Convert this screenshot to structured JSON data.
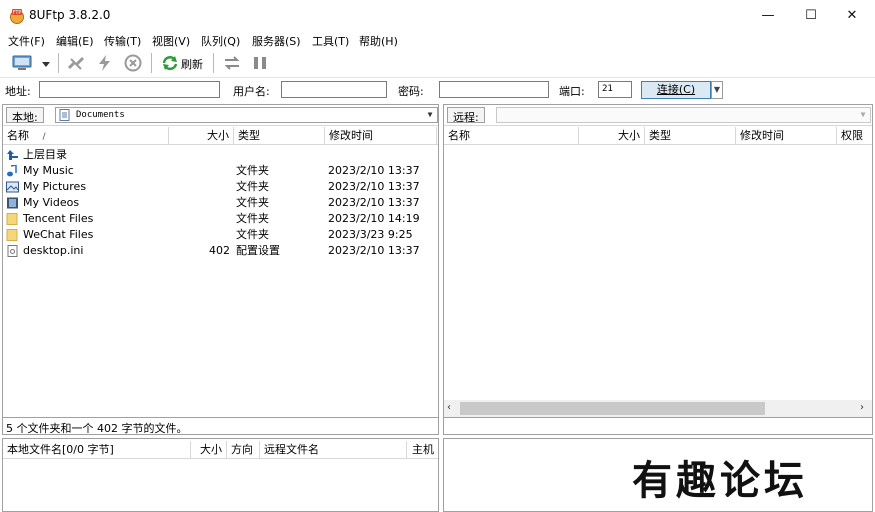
{
  "window": {
    "title": "8UFtp 3.8.2.0",
    "minimize": "—",
    "maximize": "☐",
    "close": "✕"
  },
  "menu": [
    "文件(F)",
    "编辑(E)",
    "传输(T)",
    "视图(V)",
    "队列(Q)",
    "服务器(S)",
    "工具(T)",
    "帮助(H)"
  ],
  "toolbar": {
    "refresh_label": "刷新",
    "icons": [
      "site-manager-icon",
      "dropdown-arrow-icon",
      "disconnect-icon",
      "quick-connect-icon",
      "cancel-icon",
      "refresh-icon",
      "sync-icon",
      "pause-icon"
    ]
  },
  "address_bar": {
    "address_label": "地址:",
    "address_value": "",
    "user_label": "用户名:",
    "user_value": "",
    "password_label": "密码:",
    "password_value": "",
    "port_label": "端口:",
    "port_value": "21",
    "connect_label": "连接(C)"
  },
  "local": {
    "label": "本地:",
    "path": "Documents",
    "columns": [
      "名称",
      "大小",
      "类型",
      "修改时间"
    ],
    "sort_indicator": "/",
    "files": [
      {
        "name": "上层目录",
        "size": "",
        "type": "",
        "modified": "",
        "icon": "parent-dir-icon"
      },
      {
        "name": "My Music",
        "size": "",
        "type": "文件夹",
        "modified": "2023/2/10 13:37",
        "icon": "music-folder-icon"
      },
      {
        "name": "My Pictures",
        "size": "",
        "type": "文件夹",
        "modified": "2023/2/10 13:37",
        "icon": "pictures-folder-icon"
      },
      {
        "name": "My Videos",
        "size": "",
        "type": "文件夹",
        "modified": "2023/2/10 13:37",
        "icon": "videos-folder-icon"
      },
      {
        "name": "Tencent Files",
        "size": "",
        "type": "文件夹",
        "modified": "2023/2/10 14:19",
        "icon": "folder-icon"
      },
      {
        "name": "WeChat Files",
        "size": "",
        "type": "文件夹",
        "modified": "2023/3/23 9:25",
        "icon": "folder-icon"
      },
      {
        "name": "desktop.ini",
        "size": "402",
        "type": "配置设置",
        "modified": "2023/2/10 13:37",
        "icon": "ini-file-icon"
      }
    ],
    "status": "5 个文件夹和一个 402 字节的文件。"
  },
  "remote": {
    "label": "远程:",
    "path": "",
    "columns": [
      "名称",
      "大小",
      "类型",
      "修改时间",
      "权限"
    ]
  },
  "queue": {
    "columns": [
      "本地文件名[0/0 字节]",
      "大小",
      "方向",
      "远程文件名",
      "主机"
    ]
  },
  "watermark": "有趣论坛",
  "colors": {
    "folder": "#f5d67a",
    "connect_bg": "#dbe9f5",
    "connect_border": "#3c7fb1"
  }
}
